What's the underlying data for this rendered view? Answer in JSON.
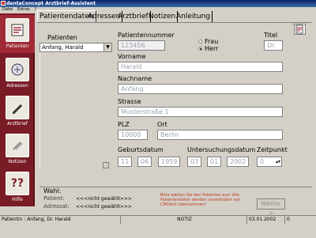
{
  "window": {
    "title": "dentaConcept Arztbrief-Assistent"
  },
  "menu": [
    "Datei",
    "Extras",
    "?"
  ],
  "sidebar": {
    "items": [
      {
        "label": "Patienten",
        "icon": "patients-icon"
      },
      {
        "label": "Adressen",
        "icon": "address-icon"
      },
      {
        "label": "Arztbrief",
        "icon": "pen-icon"
      },
      {
        "label": "Notizen",
        "icon": "notes-icon"
      },
      {
        "label": "Hilfe",
        "icon": "help-icon"
      }
    ]
  },
  "tabs": [
    "Patientendaten",
    "Adressen",
    "Arztbrief",
    "Notizen",
    "Anleitung"
  ],
  "patients": {
    "label": "Patienten",
    "selected": "Anfang, Harald"
  },
  "form": {
    "patnr_label": "Patientennummer",
    "patnr_value": "123456",
    "gender_f": "Frau",
    "gender_m": "Herr",
    "titel_label": "Titel",
    "titel_value": "Dr.",
    "vorname_label": "Vorname",
    "vorname_value": "Harald",
    "nachname_label": "Nachname",
    "nachname_value": "Anfang",
    "strasse_label": "Strasse",
    "strasse_value": "Musterstraße 1",
    "plz_label": "PLZ",
    "plz_value": "10000",
    "ort_label": "Ort",
    "ort_value": "Berlin",
    "geb_label": "Geburtsdatum",
    "geb_d": "11",
    "geb_m": "06",
    "geb_y": "1959",
    "unt_label": "Untersuchungsdatum",
    "unt_d": "03",
    "unt_m": "01",
    "unt_y": "2002",
    "zeit_label": "Zeitpunkt",
    "zeit_value": "0"
  },
  "bottom": {
    "wahl": "Wahl:",
    "patient_label": "Patient:",
    "patient_value": "<<<nicht gewählt>>>",
    "adressat_label": "Adressat:",
    "adressat_value": "<<<nicht gewählt>>>",
    "warning": "Bitte wählen Sie den Patienten aus! Alle Patientendaten werden unverändert von CMDlect übernommen!",
    "weiter": "Weiter >"
  },
  "status": {
    "patient": "Patientin : Anfang, Dr. Harald",
    "notiz": "NOTIZ",
    "date": "03.01.2002",
    "indicator": "0"
  },
  "colors": {
    "sidebar": "#7a1c26",
    "warning": "#c03a1f",
    "field_text": "#9aa0b0"
  }
}
